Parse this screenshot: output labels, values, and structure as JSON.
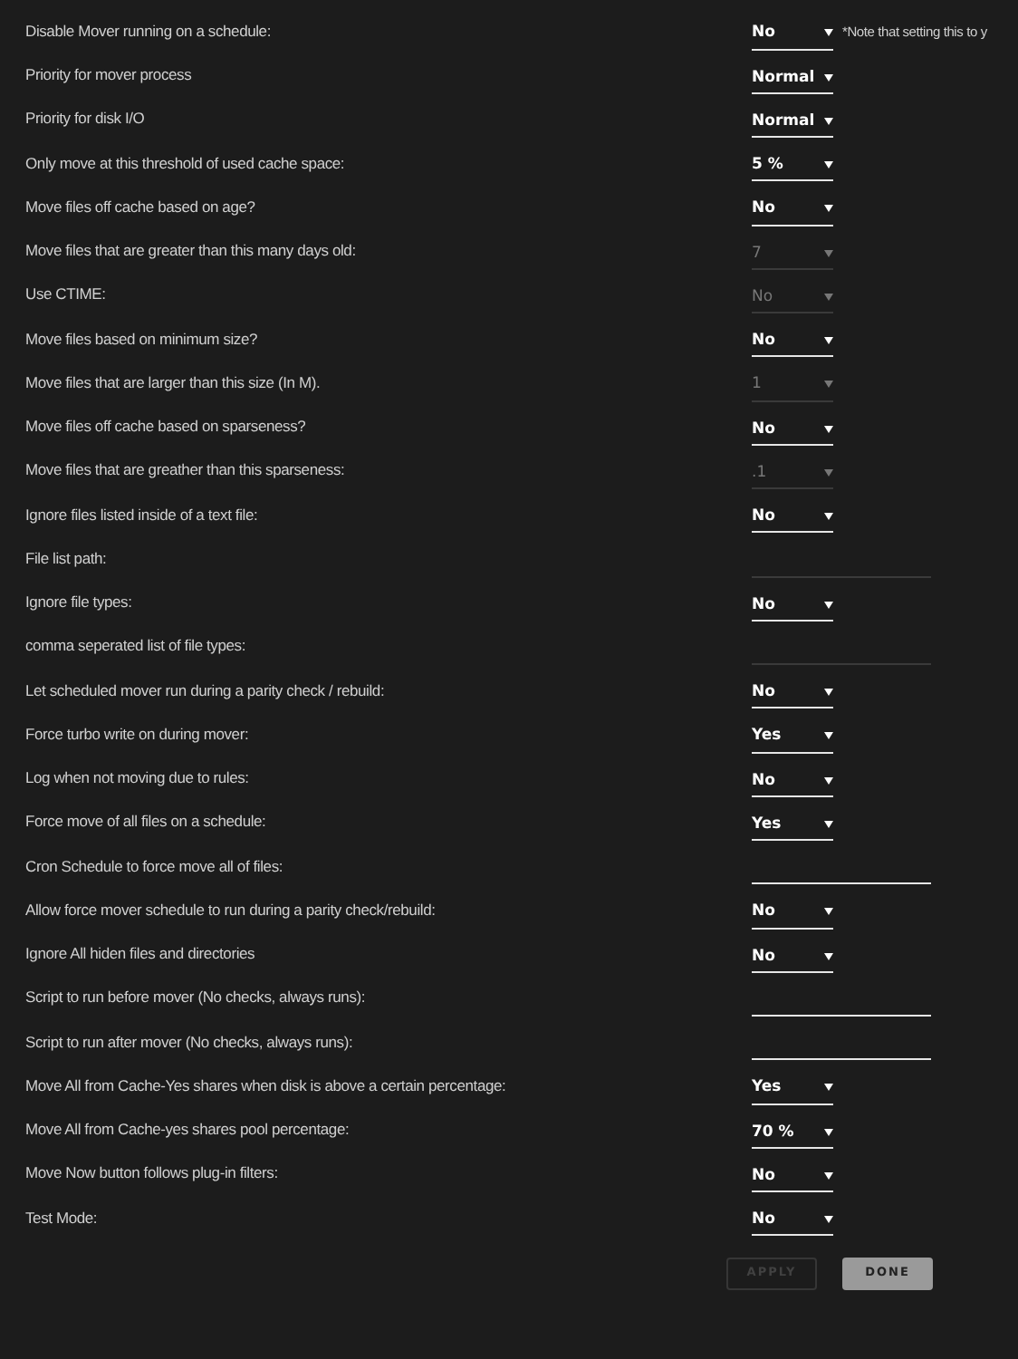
{
  "settings": [
    {
      "label": "Disable Mover running on a schedule:",
      "kind": "select",
      "value": "No",
      "disabled": false,
      "note": "*Note that setting this to y"
    },
    {
      "label": "Priority for mover process",
      "kind": "select",
      "value": "Normal",
      "disabled": false
    },
    {
      "label": "Priority for disk I/O",
      "kind": "select",
      "value": "Normal",
      "disabled": false
    },
    {
      "label": "Only move at this threshold of used cache space:",
      "kind": "select",
      "value": "5 %",
      "disabled": false
    },
    {
      "label": "Move files off cache based on age?",
      "kind": "select",
      "value": "No",
      "disabled": false
    },
    {
      "label": "Move files that are greater than this many days old:",
      "kind": "select",
      "value": "7",
      "disabled": true
    },
    {
      "label": "Use CTIME:",
      "kind": "select",
      "value": "No",
      "disabled": true
    },
    {
      "label": "Move files based on minimum size?",
      "kind": "select",
      "value": "No",
      "disabled": false
    },
    {
      "label": "Move files that are larger than this size (In M).",
      "kind": "select",
      "value": "1",
      "disabled": true
    },
    {
      "label": "Move files off cache based on sparseness?",
      "kind": "select",
      "value": "No",
      "disabled": false
    },
    {
      "label": "Move files that are greather than this sparseness:",
      "kind": "select",
      "value": ".1",
      "disabled": true
    },
    {
      "label": "Ignore files listed inside of a text file:",
      "kind": "select",
      "value": "No",
      "disabled": false
    },
    {
      "label": "File list path:",
      "kind": "text",
      "disabled": true
    },
    {
      "label": "Ignore file types:",
      "kind": "select",
      "value": "No",
      "disabled": false
    },
    {
      "label": "comma seperated list of file types:",
      "kind": "text",
      "disabled": true
    },
    {
      "label": "Let scheduled mover run during a parity check / rebuild:",
      "kind": "select",
      "value": "No",
      "disabled": false
    },
    {
      "label": "Force turbo write on during mover:",
      "kind": "select",
      "value": "Yes",
      "disabled": false
    },
    {
      "label": "Log when not moving due to rules:",
      "kind": "select",
      "value": "No",
      "disabled": false
    },
    {
      "label": "Force move of all files on a schedule:",
      "kind": "select",
      "value": "Yes",
      "disabled": false
    },
    {
      "label": "Cron Schedule to force move all of files:",
      "kind": "text",
      "disabled": false
    },
    {
      "label": "Allow force mover schedule to run during a parity check/rebuild:",
      "kind": "select",
      "value": "No",
      "disabled": false
    },
    {
      "label": "Ignore All hiden files and directories",
      "kind": "select",
      "value": "No",
      "disabled": false
    },
    {
      "label": "Script to run before mover (No checks, always runs):",
      "kind": "text",
      "disabled": false
    },
    {
      "label": "Script to run after mover (No checks, always runs):",
      "kind": "text",
      "disabled": false
    },
    {
      "label": "Move All from Cache-Yes shares when disk is above a certain percentage:",
      "kind": "select",
      "value": "Yes",
      "disabled": false
    },
    {
      "label": "Move All from Cache-yes shares pool percentage:",
      "kind": "select",
      "value": "70 %",
      "disabled": false
    },
    {
      "label": "Move Now button follows plug-in filters:",
      "kind": "select",
      "value": "No",
      "disabled": false
    },
    {
      "label": "Test Mode:",
      "kind": "select",
      "value": "No",
      "disabled": false
    }
  ],
  "buttons": [
    {
      "label": "APPLY",
      "disabled": true
    },
    {
      "label": "DONE",
      "disabled": false
    }
  ]
}
